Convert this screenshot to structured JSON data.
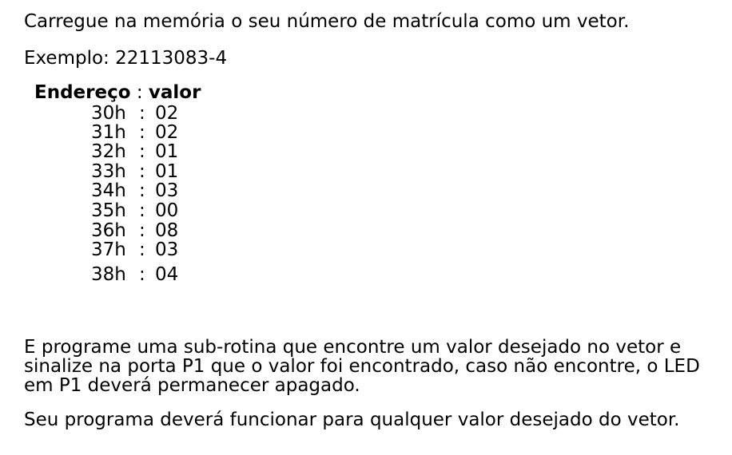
{
  "intro": "Carregue na memória o seu número de matrícula como um vetor.",
  "example": "Exemplo: 22113083-4",
  "table": {
    "header_left": "Endereço",
    "header_sep": " : ",
    "header_right": "valor",
    "rows": [
      {
        "addr": "30h",
        "sep": ":",
        "val": "02"
      },
      {
        "addr": "31h",
        "sep": ":",
        "val": "02"
      },
      {
        "addr": "32h",
        "sep": ":",
        "val": "01"
      },
      {
        "addr": "33h",
        "sep": ":",
        "val": "01"
      },
      {
        "addr": "34h",
        "sep": ":",
        "val": "03"
      },
      {
        "addr": "35h",
        "sep": ":",
        "val": "00"
      },
      {
        "addr": "36h",
        "sep": ":",
        "val": "08"
      },
      {
        "addr": "37h",
        "sep": ":",
        "val": "03"
      },
      {
        "addr": "38h",
        "sep": ":",
        "val": "04"
      }
    ]
  },
  "task": "E programe uma sub-rotina que encontre um valor desejado no vetor e sinalize na porta P1 que o valor foi encontrado, caso não encontre, o LED em P1 deverá permanecer apagado.",
  "final": "Seu programa deverá funcionar para qualquer valor desejado do vetor."
}
